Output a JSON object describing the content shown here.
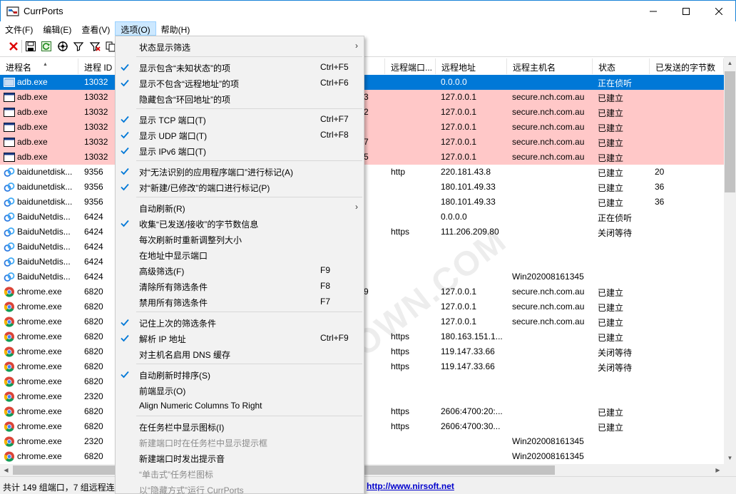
{
  "window": {
    "title": "CurrPorts"
  },
  "menubar": [
    {
      "label": "文件(F)",
      "active": false
    },
    {
      "label": "编辑(E)",
      "active": false
    },
    {
      "label": "查看(V)",
      "active": false
    },
    {
      "label": "选项(O)",
      "active": true
    },
    {
      "label": "帮助(H)",
      "active": false
    }
  ],
  "toolbar": {
    "icons": [
      "close-ports-icon",
      "save-icon",
      "refresh-icon",
      "properties-icon",
      "filter-icon",
      "filter-clear-icon",
      "copy-icon"
    ]
  },
  "columns": [
    {
      "label": "进程名",
      "sort": "▲"
    },
    {
      "label": "进程 ID"
    },
    {
      "label": "口"
    },
    {
      "label": "远程端口..."
    },
    {
      "label": "远程地址"
    },
    {
      "label": "远程主机名"
    },
    {
      "label": "状态"
    },
    {
      "label": "已发送的字节数"
    }
  ],
  "rows": [
    {
      "name": "adb.exe",
      "pid": "13032",
      "lport": "",
      "rport": "",
      "raddr": "0.0.0.0",
      "host": "",
      "state": "正在侦听",
      "sent": "",
      "icon": "adb",
      "style": "sel"
    },
    {
      "name": "adb.exe",
      "pid": "13032",
      "lport": "3",
      "rport": "",
      "raddr": "127.0.0.1",
      "host": "secure.nch.com.au",
      "state": "已建立",
      "sent": "",
      "icon": "adb",
      "style": "pink"
    },
    {
      "name": "adb.exe",
      "pid": "13032",
      "lport": "2",
      "rport": "",
      "raddr": "127.0.0.1",
      "host": "secure.nch.com.au",
      "state": "已建立",
      "sent": "",
      "icon": "adb",
      "style": "pink"
    },
    {
      "name": "adb.exe",
      "pid": "13032",
      "lport": "",
      "rport": "",
      "raddr": "127.0.0.1",
      "host": "secure.nch.com.au",
      "state": "已建立",
      "sent": "",
      "icon": "adb",
      "style": "pink"
    },
    {
      "name": "adb.exe",
      "pid": "13032",
      "lport": "7",
      "rport": "",
      "raddr": "127.0.0.1",
      "host": "secure.nch.com.au",
      "state": "已建立",
      "sent": "",
      "icon": "adb",
      "style": "pink"
    },
    {
      "name": "adb.exe",
      "pid": "13032",
      "lport": "5",
      "rport": "",
      "raddr": "127.0.0.1",
      "host": "secure.nch.com.au",
      "state": "已建立",
      "sent": "",
      "icon": "adb",
      "style": "pink"
    },
    {
      "name": "baidunetdisk...",
      "pid": "9356",
      "lport": "",
      "rport": "http",
      "raddr": "220.181.43.8",
      "host": "",
      "state": "已建立",
      "sent": "20",
      "icon": "baidu",
      "style": ""
    },
    {
      "name": "baidunetdisk...",
      "pid": "9356",
      "lport": "",
      "rport": "",
      "raddr": "180.101.49.33",
      "host": "",
      "state": "已建立",
      "sent": "36",
      "icon": "baidu",
      "style": ""
    },
    {
      "name": "baidunetdisk...",
      "pid": "9356",
      "lport": "",
      "rport": "",
      "raddr": "180.101.49.33",
      "host": "",
      "state": "已建立",
      "sent": "36",
      "icon": "baidu",
      "style": ""
    },
    {
      "name": "BaiduNetdis...",
      "pid": "6424",
      "lport": "",
      "rport": "",
      "raddr": "0.0.0.0",
      "host": "",
      "state": "正在侦听",
      "sent": "",
      "icon": "baidu",
      "style": ""
    },
    {
      "name": "BaiduNetdis...",
      "pid": "6424",
      "lport": "",
      "rport": "https",
      "raddr": "111.206.209.80",
      "host": "",
      "state": "关闭等待",
      "sent": "",
      "icon": "baidu",
      "style": ""
    },
    {
      "name": "BaiduNetdis...",
      "pid": "6424",
      "lport": "",
      "rport": "",
      "raddr": "",
      "host": "",
      "state": "",
      "sent": "",
      "icon": "baidu",
      "style": ""
    },
    {
      "name": "BaiduNetdis...",
      "pid": "6424",
      "lport": "",
      "rport": "",
      "raddr": "",
      "host": "",
      "state": "",
      "sent": "",
      "icon": "baidu",
      "style": ""
    },
    {
      "name": "BaiduNetdis...",
      "pid": "6424",
      "lport": "",
      "rport": "",
      "raddr": "",
      "host": "Win202008161345",
      "state": "",
      "sent": "",
      "icon": "baidu",
      "style": ""
    },
    {
      "name": "chrome.exe",
      "pid": "6820",
      "lport": "9",
      "rport": "",
      "raddr": "127.0.0.1",
      "host": "secure.nch.com.au",
      "state": "已建立",
      "sent": "",
      "icon": "chrome",
      "style": ""
    },
    {
      "name": "chrome.exe",
      "pid": "6820",
      "lport": "",
      "rport": "",
      "raddr": "127.0.0.1",
      "host": "secure.nch.com.au",
      "state": "已建立",
      "sent": "",
      "icon": "chrome",
      "style": ""
    },
    {
      "name": "chrome.exe",
      "pid": "6820",
      "lport": "",
      "rport": "",
      "raddr": "127.0.0.1",
      "host": "secure.nch.com.au",
      "state": "已建立",
      "sent": "",
      "icon": "chrome",
      "style": ""
    },
    {
      "name": "chrome.exe",
      "pid": "6820",
      "lport": "",
      "rport": "https",
      "raddr": "180.163.151.1...",
      "host": "",
      "state": "已建立",
      "sent": "",
      "icon": "chrome",
      "style": ""
    },
    {
      "name": "chrome.exe",
      "pid": "6820",
      "lport": "",
      "rport": "https",
      "raddr": "119.147.33.66",
      "host": "",
      "state": "关闭等待",
      "sent": "",
      "icon": "chrome",
      "style": ""
    },
    {
      "name": "chrome.exe",
      "pid": "6820",
      "lport": "",
      "rport": "https",
      "raddr": "119.147.33.66",
      "host": "",
      "state": "关闭等待",
      "sent": "",
      "icon": "chrome",
      "style": ""
    },
    {
      "name": "chrome.exe",
      "pid": "6820",
      "lport": "",
      "rport": "",
      "raddr": "",
      "host": "",
      "state": "",
      "sent": "",
      "icon": "chrome",
      "style": ""
    },
    {
      "name": "chrome.exe",
      "pid": "2320",
      "lport": "",
      "rport": "",
      "raddr": "",
      "host": "",
      "state": "",
      "sent": "",
      "icon": "chrome",
      "style": ""
    },
    {
      "name": "chrome.exe",
      "pid": "6820",
      "lport": "",
      "rport": "https",
      "raddr": "2606:4700:20:...",
      "host": "",
      "state": "已建立",
      "sent": "",
      "icon": "chrome",
      "style": ""
    },
    {
      "name": "chrome.exe",
      "pid": "6820",
      "lport": "",
      "rport": "https",
      "raddr": "2606:4700:30...",
      "host": "",
      "state": "已建立",
      "sent": "",
      "icon": "chrome",
      "style": ""
    },
    {
      "name": "chrome.exe",
      "pid": "2320",
      "lport": "",
      "rport": "",
      "raddr": "",
      "host": "Win202008161345",
      "state": "",
      "sent": "",
      "icon": "chrome",
      "style": ""
    },
    {
      "name": "chrome.exe",
      "pid": "6820",
      "lport": "",
      "rport": "",
      "raddr": "",
      "host": "Win202008161345",
      "state": "",
      "sent": "",
      "icon": "chrome",
      "style": ""
    }
  ],
  "options_menu": {
    "items": [
      {
        "label": "状态显示筛选",
        "shortcut": "",
        "checked": false,
        "submenu": true,
        "disabled": false
      },
      {
        "sep": true
      },
      {
        "label": "显示包含“未知状态”的项",
        "shortcut": "Ctrl+F5",
        "checked": true,
        "submenu": false,
        "disabled": false
      },
      {
        "label": "显示不包含“远程地址”的项",
        "shortcut": "Ctrl+F6",
        "checked": true,
        "submenu": false,
        "disabled": false
      },
      {
        "label": "隐藏包含“环回地址”的项",
        "shortcut": "",
        "checked": false,
        "submenu": false,
        "disabled": false
      },
      {
        "sep": true
      },
      {
        "label": "显示 TCP 端口(T)",
        "shortcut": "Ctrl+F7",
        "checked": true,
        "submenu": false,
        "disabled": false
      },
      {
        "label": "显示 UDP 端口(T)",
        "shortcut": "Ctrl+F8",
        "checked": true,
        "submenu": false,
        "disabled": false
      },
      {
        "label": "显示 IPv6 端口(T)",
        "shortcut": "",
        "checked": true,
        "submenu": false,
        "disabled": false
      },
      {
        "sep": true
      },
      {
        "label": "对“无法识别的应用程序端口”进行标记(A)",
        "shortcut": "",
        "checked": true,
        "submenu": false,
        "disabled": false
      },
      {
        "label": "对“新建/已修改”的端口进行标记(P)",
        "shortcut": "",
        "checked": true,
        "submenu": false,
        "disabled": false
      },
      {
        "sep": true
      },
      {
        "label": "自动刷新(R)",
        "shortcut": "",
        "checked": false,
        "submenu": true,
        "disabled": false
      },
      {
        "label": "收集“已发送/接收”的字节数信息",
        "shortcut": "",
        "checked": true,
        "submenu": false,
        "disabled": false
      },
      {
        "label": "每次刷新时重新调整列大小",
        "shortcut": "",
        "checked": false,
        "submenu": false,
        "disabled": false
      },
      {
        "label": "在地址中显示端口",
        "shortcut": "",
        "checked": false,
        "submenu": false,
        "disabled": false
      },
      {
        "label": "高级筛选(F)",
        "shortcut": "F9",
        "checked": false,
        "submenu": false,
        "disabled": false
      },
      {
        "label": "清除所有筛选条件",
        "shortcut": "F8",
        "checked": false,
        "submenu": false,
        "disabled": false
      },
      {
        "label": "禁用所有筛选条件",
        "shortcut": "F7",
        "checked": false,
        "submenu": false,
        "disabled": false
      },
      {
        "sep": true
      },
      {
        "label": "记住上次的筛选条件",
        "shortcut": "",
        "checked": true,
        "submenu": false,
        "disabled": false
      },
      {
        "label": "解析 IP 地址",
        "shortcut": "Ctrl+F9",
        "checked": true,
        "submenu": false,
        "disabled": false
      },
      {
        "label": "对主机名启用 DNS 缓存",
        "shortcut": "",
        "checked": false,
        "submenu": false,
        "disabled": false
      },
      {
        "sep": true
      },
      {
        "label": "自动刷新时排序(S)",
        "shortcut": "",
        "checked": true,
        "submenu": false,
        "disabled": false
      },
      {
        "label": "前端显示(O)",
        "shortcut": "",
        "checked": false,
        "submenu": false,
        "disabled": false
      },
      {
        "label": "Align Numeric Columns To Right",
        "shortcut": "",
        "checked": false,
        "submenu": false,
        "disabled": false
      },
      {
        "sep": true
      },
      {
        "label": "在任务栏中显示图标(I)",
        "shortcut": "",
        "checked": false,
        "submenu": false,
        "disabled": false
      },
      {
        "label": "新建端口时在任务栏中显示提示框",
        "shortcut": "",
        "checked": false,
        "submenu": false,
        "disabled": true
      },
      {
        "label": "新建端口时发出提示音",
        "shortcut": "",
        "checked": false,
        "submenu": false,
        "disabled": false
      },
      {
        "label": "“单击式”任务栏图标",
        "shortcut": "",
        "checked": false,
        "submenu": false,
        "disabled": true
      },
      {
        "label": "以“隐藏方式”运行 CurrPorts",
        "shortcut": "",
        "checked": false,
        "submenu": false,
        "disabled": true
      }
    ]
  },
  "statusbar": {
    "text": "共计 149 组端口，7 组远程连",
    "link": "http://www.nirsoft.net"
  },
  "watermark": "WEIDOWN.COM",
  "colors": {
    "selection": "#0078d7",
    "highlight_row": "#ffc8c8",
    "menu_check": "#0078d7",
    "link": "#0000cc"
  }
}
